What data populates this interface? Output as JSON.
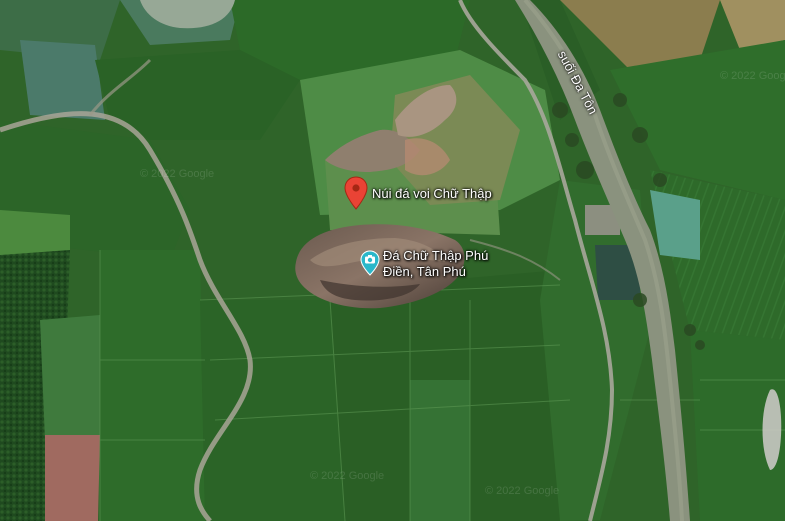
{
  "map": {
    "type": "satellite",
    "stream_label": "suối Đa Tôn",
    "places": [
      {
        "label": "Núi đá voi Chữ Thập",
        "icon": "red-pin-icon",
        "color": "#ea4335"
      },
      {
        "label_line1": "Đá Chữ Thập Phú",
        "label_line2": "Điền, Tân Phú",
        "icon": "camera-pin-icon",
        "color": "#2ab7c9"
      }
    ],
    "watermark": "© 2022 Google"
  }
}
